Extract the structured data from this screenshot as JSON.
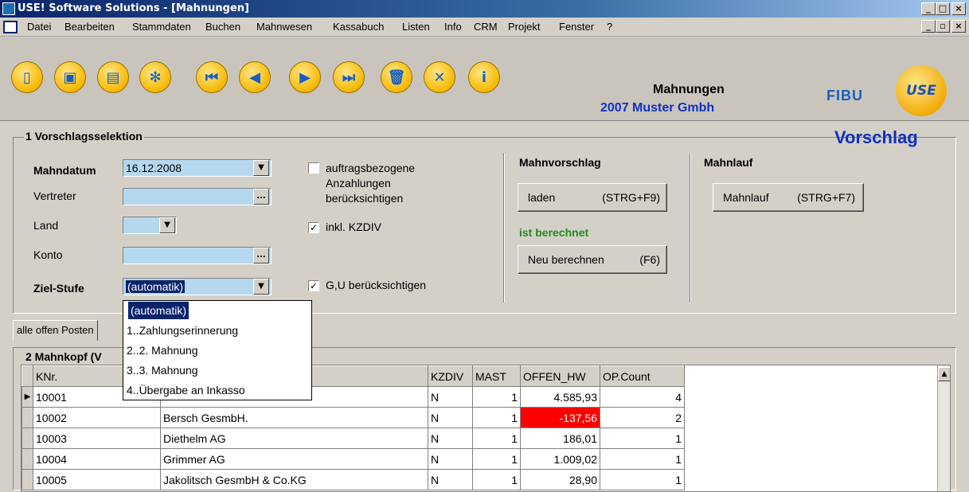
{
  "window": {
    "title": "USE! Software Solutions - [Mahnungen]",
    "controls": [
      "_",
      "□",
      "×"
    ],
    "child_controls": [
      "_",
      "▫",
      "×"
    ]
  },
  "menu": [
    "Datei",
    "Bearbeiten",
    "Stammdaten",
    "Buchen",
    "Mahnwesen",
    "Kassabuch",
    "Listen",
    "Info",
    "CRM",
    "Projekt",
    "Fenster",
    "?"
  ],
  "toolbar": {
    "icons": [
      "new-icon",
      "save-icon",
      "print-icon",
      "shower-icon",
      "first-record-icon",
      "previous-record-icon",
      "next-record-icon",
      "last-record-icon",
      "trash-icon",
      "delete-icon",
      "info-icon"
    ],
    "form_title": "Mahnungen",
    "company": "2007 Muster Gmbh",
    "fibu_label": "FIBU",
    "logo_text": "USE"
  },
  "section1": {
    "title": "1 Vorschlagsselektion",
    "mode": "Vorschlag",
    "mahndatum_label": "Mahndatum",
    "mahndatum_value": "16.12.2008",
    "vertreter_label": "Vertreter",
    "land_label": "Land",
    "konto_label": "Konto",
    "zielstufe_label": "Ziel-Stufe",
    "zielstufe_value": "(automatik)",
    "browse_glyph": "...",
    "dropdown_glyph": "▼",
    "chk_auftrag_label": "auftragsbezogene Anzahlungen berücksichtigen",
    "chk_auftrag": false,
    "chk_kzdiv_label": "inkl. KZDIV",
    "chk_kzdiv": true,
    "chk_gu_label": "G,U berücksichtigen",
    "chk_gu": true,
    "mahnvorschlag_title": "Mahnvorschlag",
    "laden_label": "laden",
    "laden_shortcut": "(STRG+F9)",
    "status": "ist berechnet",
    "neu_label": "Neu berechnen",
    "neu_shortcut": "(F6)",
    "mahnlauf_title": "Mahnlauf",
    "mahnlauf_label": "Mahnlauf",
    "mahnlauf_shortcut": "(STRG+F7)"
  },
  "dropdown": {
    "options": [
      "(automatik)",
      "1..Zahlungserinnerung",
      "2..2. Mahnung",
      "3..3. Mahnung",
      "4..Übergabe an Inkasso"
    ],
    "selected": 0
  },
  "tabs": {
    "active": "alle offen Posten"
  },
  "section2": {
    "title": "2 Mahnkopf (V",
    "columns": [
      "KNr.",
      "",
      "KZDIV",
      "MAST",
      "OFFEN_HW",
      "OP.Count"
    ],
    "rows": [
      {
        "knr": "10001",
        "name": "",
        "kzdiv": "N",
        "mast": "1",
        "offen": "4.585,93",
        "count": "4",
        "current": true
      },
      {
        "knr": "10002",
        "name": "Bersch GesmbH.",
        "kzdiv": "N",
        "mast": "1",
        "offen": "-137,56",
        "count": "2",
        "negative": true
      },
      {
        "knr": "10003",
        "name": "Diethelm AG",
        "kzdiv": "N",
        "mast": "1",
        "offen": "186,01",
        "count": "1"
      },
      {
        "knr": "10004",
        "name": "Grimmer AG",
        "kzdiv": "N",
        "mast": "1",
        "offen": "1.009,02",
        "count": "1"
      },
      {
        "knr": "10005",
        "name": "Jakolitsch GesmbH & Co.KG",
        "kzdiv": "N",
        "mast": "1",
        "offen": "28,90",
        "count": "1"
      }
    ]
  }
}
